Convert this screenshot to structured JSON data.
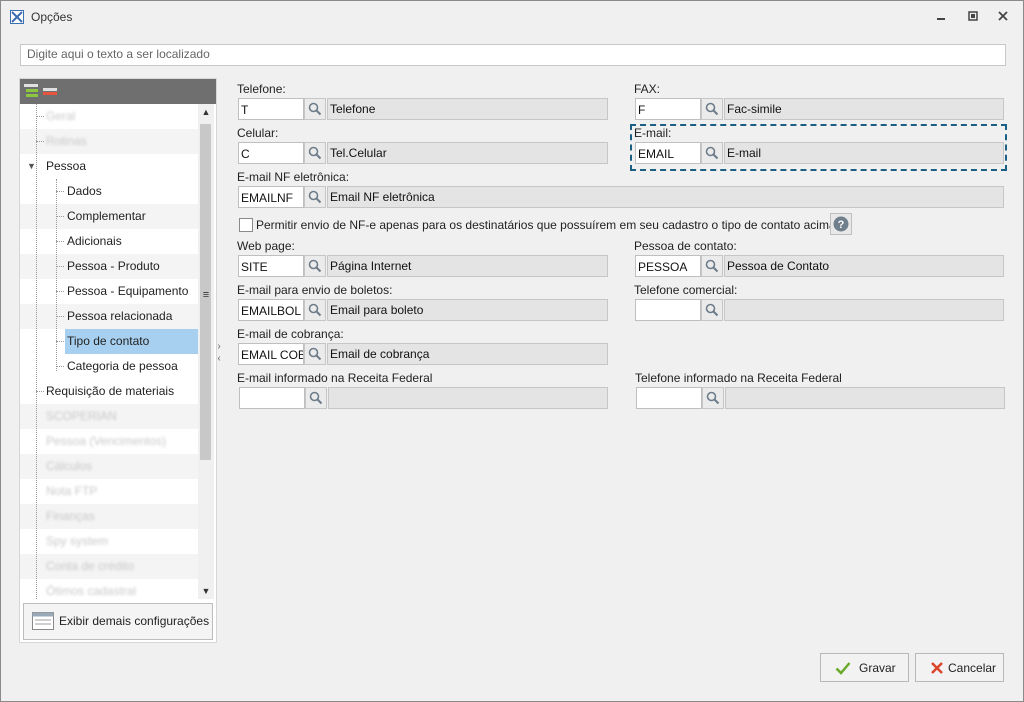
{
  "window": {
    "title": "Opções"
  },
  "search": {
    "placeholder": "Digite aqui o texto a ser localizado"
  },
  "tree": {
    "items": [
      {
        "label": "Geral",
        "blurred": true
      },
      {
        "label": "Rotinas",
        "blurred": true
      },
      {
        "label": "Pessoa",
        "blurred": false
      },
      {
        "label": "Dados",
        "blurred": false
      },
      {
        "label": "Complementar",
        "blurred": false
      },
      {
        "label": "Adicionais",
        "blurred": false
      },
      {
        "label": "Pessoa - Produto",
        "blurred": false
      },
      {
        "label": "Pessoa - Equipamento",
        "blurred": false
      },
      {
        "label": "Pessoa relacionada",
        "blurred": false
      },
      {
        "label": "Tipo de contato",
        "blurred": false,
        "selected": true
      },
      {
        "label": "Categoria de pessoa",
        "blurred": false
      },
      {
        "label": "Requisição de materiais",
        "blurred": false
      },
      {
        "label": "SCOPERIAN",
        "blurred": true
      },
      {
        "label": "Pessoa (Vencimentos)",
        "blurred": true
      },
      {
        "label": "Cálculos",
        "blurred": true
      },
      {
        "label": "Nota FTP",
        "blurred": true
      },
      {
        "label": "Finanças",
        "blurred": true
      },
      {
        "label": "Spy system",
        "blurred": true
      },
      {
        "label": "Conta de crédito",
        "blurred": true
      },
      {
        "label": "Ótimos cadastral",
        "blurred": true
      }
    ],
    "more_button_label": "Exibir demais configurações"
  },
  "form": {
    "telefone": {
      "label": "Telefone:",
      "code": "T",
      "desc": "Telefone"
    },
    "fax": {
      "label": "FAX:",
      "code": "F",
      "desc": "Fac-simile"
    },
    "celular": {
      "label": "Celular:",
      "code": "C",
      "desc": "Tel.Celular"
    },
    "email": {
      "label": "E-mail:",
      "code": "EMAIL",
      "desc": "E-mail"
    },
    "email_nf": {
      "label": "E-mail NF eletrônica:",
      "code": "EMAILNF",
      "desc": "Email NF eletrônica"
    },
    "permitir_checkbox": {
      "label": "Permitir envio de NF-e apenas para os destinatários que possuírem em seu cadastro o tipo de contato acima",
      "checked": false
    },
    "web_page": {
      "label": "Web page:",
      "code": "SITE",
      "desc": "Página Internet"
    },
    "pessoa_contato": {
      "label": "Pessoa de contato:",
      "code": "PESSOA",
      "desc": "Pessoa de Contato"
    },
    "email_boletos": {
      "label": "E-mail para envio de boletos:",
      "code": "EMAILBOL",
      "desc": "Email para boleto"
    },
    "telefone_comercial": {
      "label": "Telefone comercial:",
      "code": "",
      "desc": ""
    },
    "email_cobranca": {
      "label": "E-mail de cobrança:",
      "code": "EMAIL COBR",
      "desc": "Email de cobrança"
    },
    "email_receita": {
      "label": "E-mail informado na Receita Federal",
      "code": "",
      "desc": ""
    },
    "telefone_receita": {
      "label": "Telefone informado na Receita Federal",
      "code": "",
      "desc": ""
    }
  },
  "buttons": {
    "gravar": "Gravar",
    "cancelar": "Cancelar"
  },
  "colors": {
    "selected": "#a7d0f0",
    "focus_border": "#1b5f85",
    "save_check": "#6aaa2a",
    "cancel_x": "#d9442b"
  }
}
